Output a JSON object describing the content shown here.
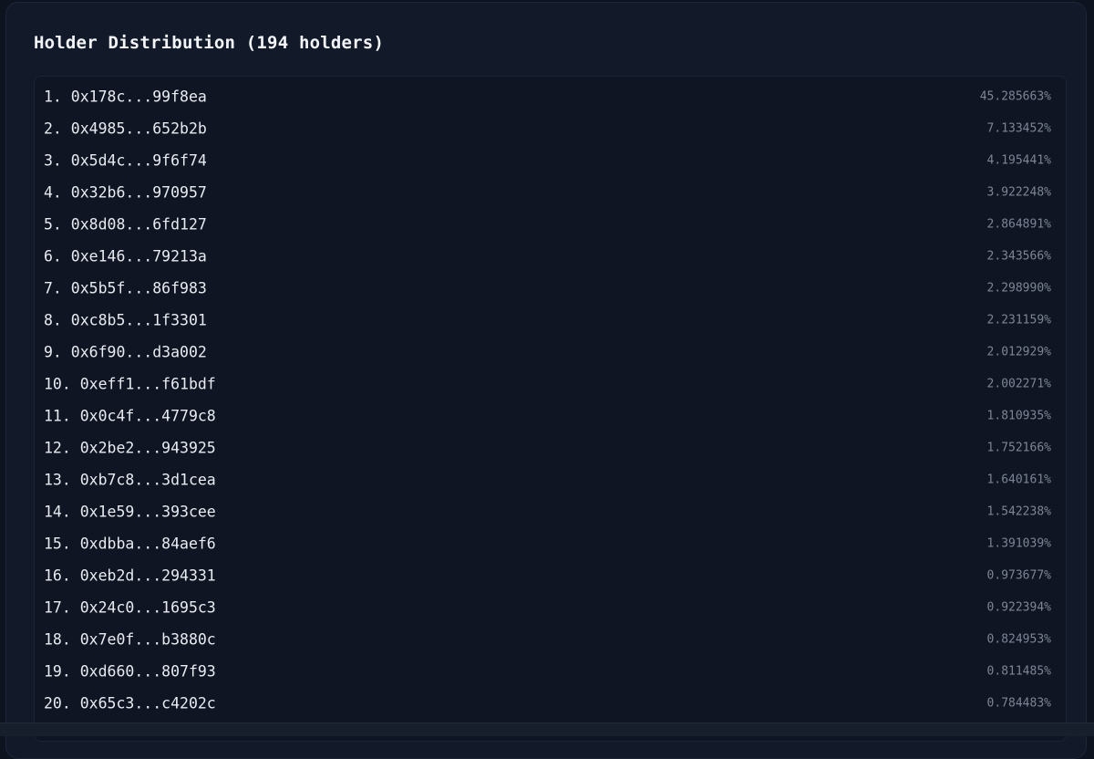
{
  "title": "Holder Distribution (194 holders)",
  "holders": [
    {
      "label": "1. 0x178c...99f8ea",
      "pct": "45.285663%"
    },
    {
      "label": "2. 0x4985...652b2b",
      "pct": "7.133452%"
    },
    {
      "label": "3. 0x5d4c...9f6f74",
      "pct": "4.195441%"
    },
    {
      "label": "4. 0x32b6...970957",
      "pct": "3.922248%"
    },
    {
      "label": "5. 0x8d08...6fd127",
      "pct": "2.864891%"
    },
    {
      "label": "6. 0xe146...79213a",
      "pct": "2.343566%"
    },
    {
      "label": "7. 0x5b5f...86f983",
      "pct": "2.298990%"
    },
    {
      "label": "8. 0xc8b5...1f3301",
      "pct": "2.231159%"
    },
    {
      "label": "9. 0x6f90...d3a002",
      "pct": "2.012929%"
    },
    {
      "label": "10. 0xeff1...f61bdf",
      "pct": "2.002271%"
    },
    {
      "label": "11. 0x0c4f...4779c8",
      "pct": "1.810935%"
    },
    {
      "label": "12. 0x2be2...943925",
      "pct": "1.752166%"
    },
    {
      "label": "13. 0xb7c8...3d1cea",
      "pct": "1.640161%"
    },
    {
      "label": "14. 0x1e59...393cee",
      "pct": "1.542238%"
    },
    {
      "label": "15. 0xdbba...84aef6",
      "pct": "1.391039%"
    },
    {
      "label": "16. 0xeb2d...294331",
      "pct": "0.973677%"
    },
    {
      "label": "17. 0x24c0...1695c3",
      "pct": "0.922394%"
    },
    {
      "label": "18. 0x7e0f...b3880c",
      "pct": "0.824953%"
    },
    {
      "label": "19. 0xd660...807f93",
      "pct": "0.811485%"
    },
    {
      "label": "20. 0x65c3...c4202c",
      "pct": "0.784483%"
    }
  ]
}
